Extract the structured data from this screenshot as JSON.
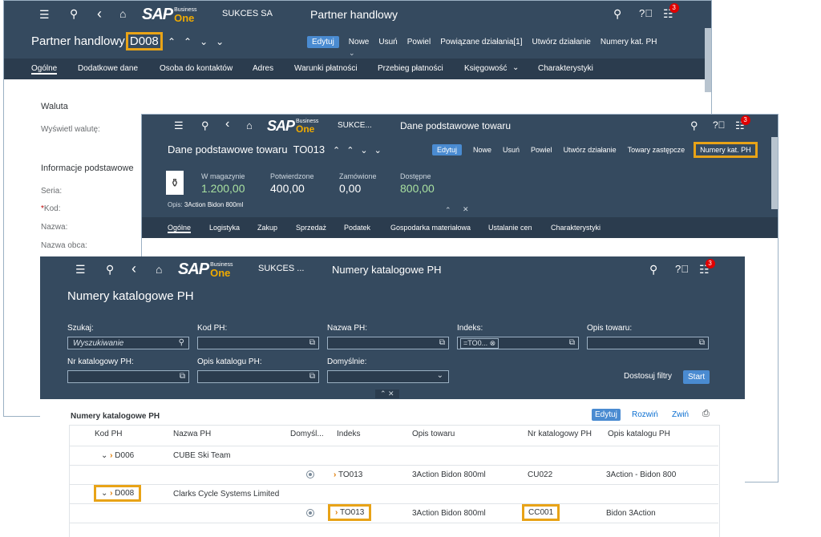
{
  "colors": {
    "shell": "#354a5f",
    "tabs": "#2b3c4e",
    "accent": "#4a8bd1",
    "highlight": "#e8a317",
    "badge": "#e00000",
    "green": "#a8e0a0"
  },
  "icons": [
    "menu-icon",
    "user-icon",
    "back-icon",
    "home-icon",
    "search-icon",
    "help-icon",
    "notifications-icon",
    "chevron-up-icon",
    "chevron-down-icon",
    "collapse-icon",
    "pin-icon",
    "value-help-icon",
    "dropdown-icon",
    "clear-icon",
    "export-icon"
  ],
  "brand": {
    "sap": "SAP",
    "business": "Business",
    "one": "One"
  },
  "win1": {
    "company": "SUKCES SA",
    "shell_title": "Partner handlowy",
    "badge": "3",
    "title_prefix": "Partner handlowy",
    "title_code": "D008",
    "actions": [
      "Edytuj",
      "Nowe",
      "Usuń",
      "Powiel",
      "Powiązane działania[1]",
      "Utwórz działanie",
      "Numery kat. PH"
    ],
    "tabs": [
      "Ogólne",
      "Dodatkowe dane",
      "Osoba do kontaktów",
      "Adres",
      "Warunki płatności",
      "Przebieg płatności",
      "Księgowość",
      "Charakterystyki"
    ],
    "section_currency": "Waluta",
    "show_currency": "Wyświetl walutę:",
    "section_basic": "Informacje podstawowe",
    "field_series": "Seria:",
    "field_code_star": "*",
    "field_code": "Kod:",
    "field_name": "Nazwa:",
    "field_foreign": "Nazwa obca:"
  },
  "win2": {
    "company": "SUKCE...",
    "shell_title": "Dane podstawowe towaru",
    "badge": "3",
    "title": "Dane podstawowe towaru  TO013",
    "actions": [
      "Edytuj",
      "Nowe",
      "Usuń",
      "Powiel",
      "Utwórz działanie",
      "Towary zastępcze",
      "Numery kat. PH"
    ],
    "kpis": [
      {
        "label": "W magazynie",
        "value": "1.200,00"
      },
      {
        "label": "Potwierdzone",
        "value": "400,00"
      },
      {
        "label": "Zamówione",
        "value": "0,00"
      },
      {
        "label": "Dostępne",
        "value": "800,00"
      }
    ],
    "desc_label": "Opis:",
    "desc_value": "3Action Bidon 800ml",
    "tabs": [
      "Ogólne",
      "Logistyka",
      "Zakup",
      "Sprzedaż",
      "Podatek",
      "Gospodarka materiałowa",
      "Ustalanie cen",
      "Charakterystyki"
    ]
  },
  "win3": {
    "company": "SUKCES ...",
    "shell_title": "Numery katalogowe PH",
    "badge": "3",
    "title": "Numery katalogowe PH",
    "filters": {
      "search_label": "Szukaj:",
      "search_placeholder": "Wyszukiwanie",
      "kod_label": "Kod PH:",
      "nazwa_label": "Nazwa PH:",
      "indeks_label": "Indeks:",
      "indeks_token": "=TO0...",
      "opis_label": "Opis towaru:",
      "nr_label": "Nr katalogowy PH:",
      "opiskat_label": "Opis katalogu PH:",
      "domysl_label": "Domyślnie:",
      "adapt": "Dostosuj filtry",
      "start": "Start"
    },
    "table": {
      "title": "Numery katalogowe PH",
      "edit": "Edytuj",
      "expand": "Rozwiń",
      "collapse": "Zwiń",
      "columns": [
        "Kod PH",
        "Nazwa PH",
        "Domyśl...",
        "Indeks",
        "Opis towaru",
        "Nr katalogowy PH",
        "Opis katalogu PH"
      ],
      "rows": [
        {
          "kod": "D006",
          "nazwa": "CUBE Ski Team"
        },
        {
          "indeks": "TO013",
          "opis": "3Action Bidon 800ml",
          "nr": "CU022",
          "opiskat": "3Action - Bidon 800"
        },
        {
          "kod": "D008",
          "nazwa": "Clarks Cycle Systems Limited"
        },
        {
          "indeks": "TO013",
          "opis": "3Action Bidon 800ml",
          "nr": "CC001",
          "opiskat": "Bidon 3Action"
        }
      ]
    }
  }
}
